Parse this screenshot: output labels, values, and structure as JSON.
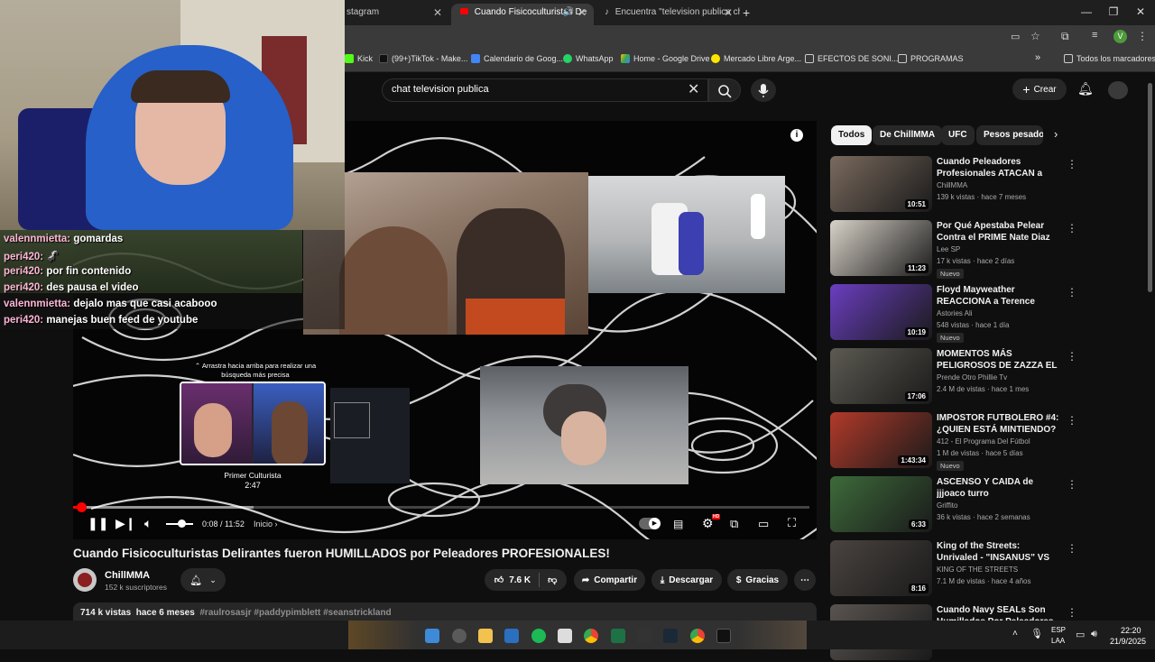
{
  "browser": {
    "tabs": [
      {
        "label": "stagram",
        "active": false
      },
      {
        "label": "Cuando Fisicoculturistas De",
        "active": true
      },
      {
        "label": "Encuentra \"television publica ch",
        "active": false
      }
    ],
    "new_tab": "+",
    "profile_initial": "V",
    "bookmarks": [
      "Kick",
      "(99+)TikTok - Make...",
      "Calendario de Goog...",
      "WhatsApp",
      "Home - Google Drive",
      "Mercado Libre Arge...",
      "EFECTOS DE SONI...",
      "PROGRAMAS"
    ],
    "all_bookmarks": "Todos los marcadores",
    "more": "»"
  },
  "header": {
    "search_value": "chat television publica",
    "create_label": "Crear"
  },
  "stream": {
    "chat": [
      {
        "user": "valennmietta:",
        "msg": "gomardas"
      },
      {
        "user": "peri420:",
        "msg": "🦨"
      },
      {
        "user": "peri420:",
        "msg": "por fin contenido"
      },
      {
        "user": "peri420:",
        "msg": "des pausa el video"
      },
      {
        "user": "valennmietta:",
        "msg": "dejalo mas que casi acabooo"
      },
      {
        "user": "peri420:",
        "msg": "manejas buen feed de youtube"
      }
    ]
  },
  "player": {
    "current_time": "0:08 / 11:52",
    "chapter": "Inicio",
    "progress": 0.011,
    "preview_hint": "⌃ Arrastra hacia arriba para realizar una búsqueda más precisa",
    "preview_title": "Primer Culturista",
    "preview_time": "2:47",
    "hd_badge": "HD"
  },
  "video": {
    "title": "Cuando Fisicoculturistas Delirantes fueron HUMILLADOS por Peleadores PROFESIONALES!",
    "channel": "ChillMMA",
    "subscribers": "152 k suscriptores",
    "likes": "7.6 K",
    "share": "Compartir",
    "download": "Descargar",
    "thanks": "Gracias",
    "views": "714 k vistas",
    "age": "hace 6 meses",
    "tags": "#raulrosasjr #paddypimblett #seanstrickland"
  },
  "sidebar": {
    "chips": [
      "Todos",
      "De ChillMMA",
      "UFC",
      "Pesos pesado"
    ],
    "recs": [
      {
        "title": "Cuando Peleadores Profesionales ATACAN a Troll...",
        "channel": "ChillMMA",
        "meta": "139 k vistas · hace 7 meses",
        "duration": "10:51",
        "badge": "",
        "color": "#7a6a5e"
      },
      {
        "title": "Por Qué Apestaba Pelear Contra el PRIME Nate Diaz",
        "channel": "Lee SP",
        "meta": "17 k vistas · hace 2 días",
        "duration": "11:23",
        "badge": "Nuevo",
        "color": "#d8d2c8"
      },
      {
        "title": "Floyd Mayweather REACCIONA a Terence Crawford ...",
        "channel": "Astories Ali",
        "meta": "548 vistas · hace 1 día",
        "duration": "10:19",
        "badge": "Nuevo",
        "color": "#6a3ec0"
      },
      {
        "title": "MOMENTOS MÁS PELIGROSOS DE ZAZZA EL ITALIANO",
        "channel": "Prende Otro Phillie Tv",
        "meta": "2.4 M de vistas · hace 1 mes",
        "duration": "17:06",
        "badge": "",
        "color": "#5d5a52"
      },
      {
        "title": "IMPOSTOR FUTBOLERO #4: ¿QUIEN ESTÁ MINTIENDO? - ...",
        "channel": "412 - El Programa Del Fútbol",
        "meta": "1 M de vistas · hace 5 días",
        "duration": "1:43:34",
        "badge": "Nuevo",
        "color": "#b23a2a"
      },
      {
        "title": "ASCENSO Y CAIDA de jjjoaco turro",
        "channel": "Griffito",
        "meta": "36 k vistas · hace 2 semanas",
        "duration": "6:33",
        "badge": "",
        "color": "#3d6b3a"
      },
      {
        "title": "King of the Streets: Unrivaled - \"INSANUS\" VS \"SHOOTER\"",
        "channel": "KING OF THE STREETS",
        "meta": "7.1 M de vistas · hace 4 años",
        "duration": "8:16",
        "badge": "",
        "color": "#4a4440"
      },
      {
        "title": "Cuando Navy SEALs Son Humillados Por Peleadores ...",
        "channel": "",
        "meta": "",
        "duration": "",
        "badge": "",
        "color": "#5a5450"
      }
    ]
  },
  "taskbar": {
    "lang_top": "ESP",
    "lang_bottom": "LAA",
    "time": "22:20",
    "date": "21/9/2025"
  }
}
